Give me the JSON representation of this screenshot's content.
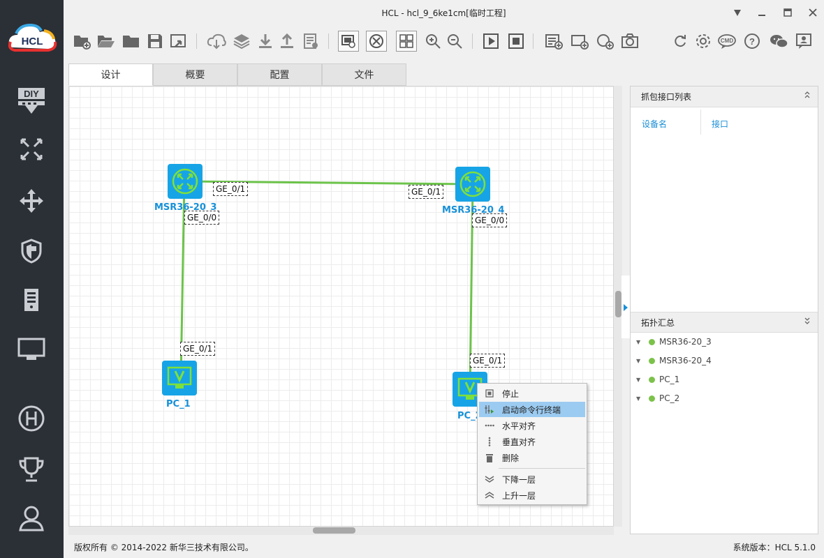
{
  "window": {
    "title": "HCL - hcl_9_6ke1cm[临时工程]"
  },
  "logo": {
    "text": "HCL"
  },
  "sidebar": {
    "items": [
      {
        "name": "diy-icon",
        "label": "DIY"
      },
      {
        "name": "network-icon"
      },
      {
        "name": "move-icon"
      },
      {
        "name": "shield-icon"
      },
      {
        "name": "server-icon"
      },
      {
        "name": "monitor-icon"
      },
      {
        "name": "h-logo-icon"
      },
      {
        "name": "trophy-icon"
      },
      {
        "name": "user-icon"
      }
    ]
  },
  "toolbar": {
    "right_labels": {
      "cmd": "CMD"
    }
  },
  "tabs": [
    {
      "label": "设计",
      "active": true
    },
    {
      "label": "概要",
      "active": false
    },
    {
      "label": "配置",
      "active": false
    },
    {
      "label": "文件",
      "active": false
    }
  ],
  "topology": {
    "link_color": "#6cc34a",
    "device_color": "#17a4e6",
    "devices": [
      {
        "id": "r3",
        "label": "MSR36-20_3",
        "type": "router"
      },
      {
        "id": "r4",
        "label": "MSR36-20_4",
        "type": "router"
      },
      {
        "id": "pc1",
        "label": "PC_1",
        "type": "pc"
      },
      {
        "id": "pc2",
        "label": "PC_2",
        "type": "pc"
      }
    ],
    "ports": [
      {
        "device": "r3",
        "label": "GE_0/1"
      },
      {
        "device": "r3",
        "label": "GE_0/0"
      },
      {
        "device": "r4",
        "label": "GE_0/1"
      },
      {
        "device": "r4",
        "label": "GE_0/0"
      },
      {
        "device": "pc1",
        "label": "GE_0/1"
      },
      {
        "device": "pc2",
        "label": "GE_0/1"
      }
    ]
  },
  "capture_panel": {
    "title": "抓包接口列表",
    "columns": [
      "设备名",
      "接口"
    ]
  },
  "topology_summary": {
    "title": "拓扑汇总",
    "items": [
      "MSR36-20_3",
      "MSR36-20_4",
      "PC_1",
      "PC_2"
    ],
    "status_color": "#7cc24a"
  },
  "context_menu": {
    "items": [
      {
        "label": "停止",
        "icon": "stop-icon"
      },
      {
        "label": "启动命令行终端",
        "icon": "terminal-icon",
        "highlighted": true
      },
      {
        "label": "水平对齐",
        "icon": "align-horizontal-icon"
      },
      {
        "label": "垂直对齐",
        "icon": "align-vertical-icon"
      },
      {
        "label": "删除",
        "icon": "trash-icon"
      },
      {
        "label": "下降一层",
        "icon": "layer-down-icon"
      },
      {
        "label": "上升一层",
        "icon": "layer-up-icon"
      }
    ]
  },
  "status_bar": {
    "copyright": "版权所有 © 2014-2022 新华三技术有限公司。",
    "version": "系统版本：HCL 5.1.0"
  }
}
